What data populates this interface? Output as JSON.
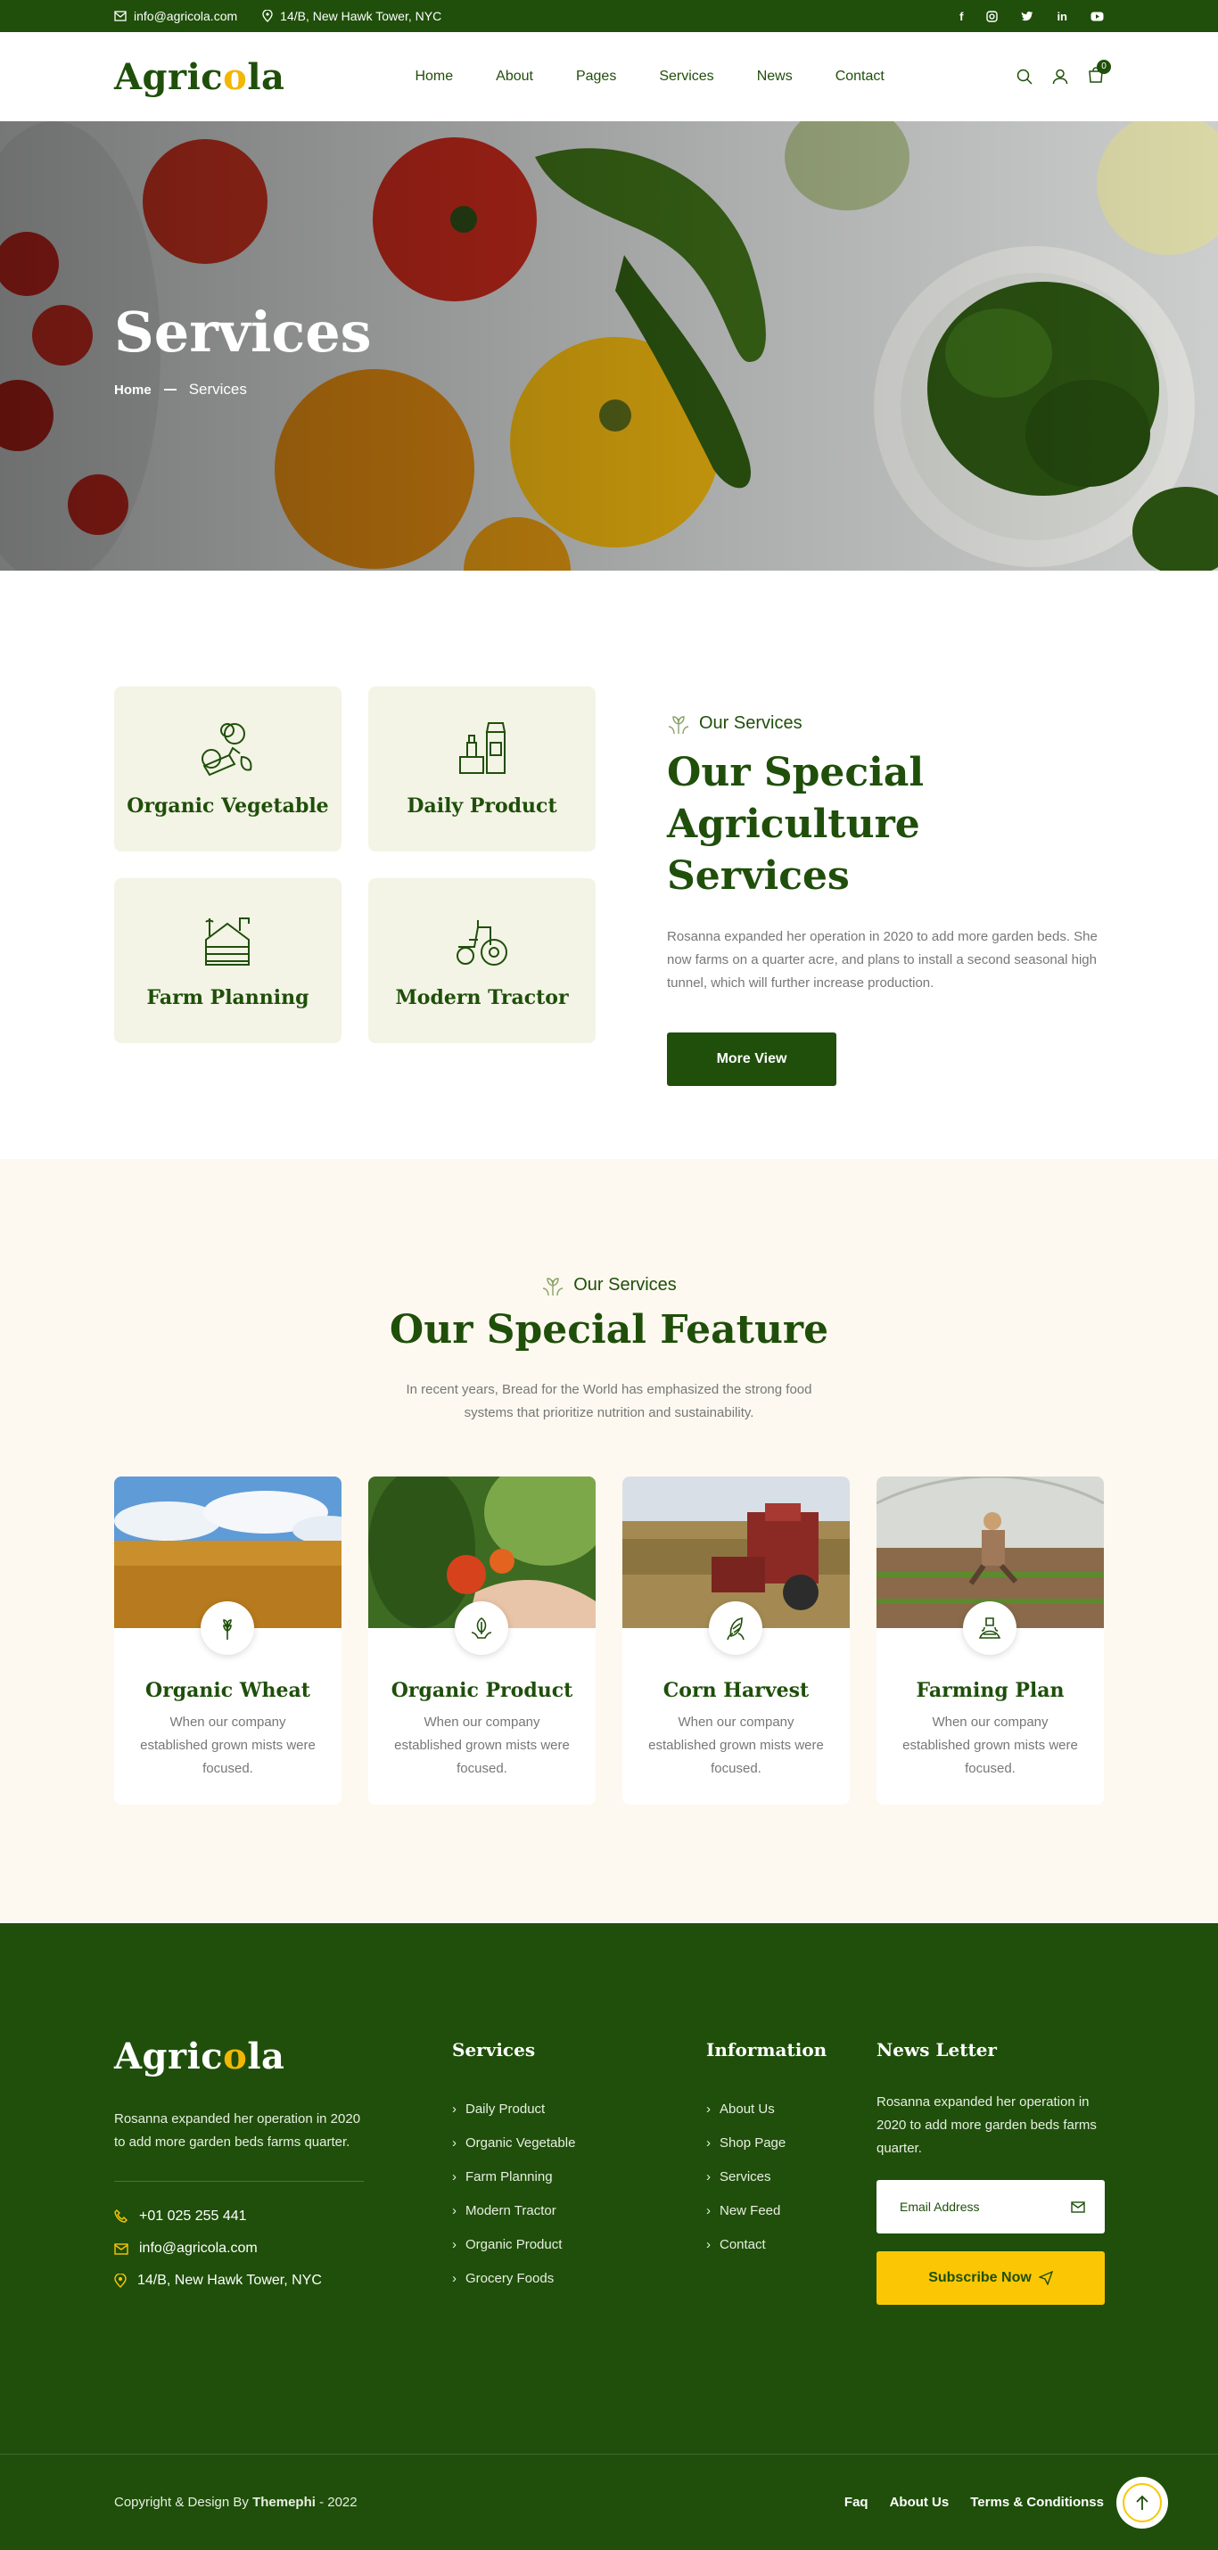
{
  "topbar": {
    "email": "info@agricola.com",
    "address": "14/B, New Hawk Tower, NYC",
    "social": [
      "f",
      "ig",
      "tw",
      "in",
      "yt"
    ]
  },
  "header": {
    "logo_pre": "Agric",
    "logo_o": "o",
    "logo_post": "la",
    "nav": [
      "Home",
      "About",
      "Pages",
      "Services",
      "News",
      "Contact"
    ],
    "cart_count": "0"
  },
  "hero": {
    "title": "Services",
    "breadcrumb_home": "Home",
    "breadcrumb_current": "Services"
  },
  "services": {
    "cards": [
      "Organic Vegetable",
      "Daily Product",
      "Farm Planning",
      "Modern Tractor"
    ],
    "tag": "Our Services",
    "title": "Our Special Agriculture Services",
    "text": "Rosanna expanded her operation in 2020 to add more garden beds. She now farms on a quarter acre, and plans to install a second seasonal high tunnel, which will further increase production.",
    "button": "More View"
  },
  "feature": {
    "tag": "Our Services",
    "title": "Our Special Feature",
    "text": "In recent years, Bread for the World has emphasized the strong food systems that prioritize nutrition and sustainability.",
    "cards": [
      {
        "title": "Organic Wheat",
        "text": "When our company established grown mists were focused."
      },
      {
        "title": "Organic Product",
        "text": "When our company established grown mists were focused."
      },
      {
        "title": "Corn Harvest",
        "text": "When our company established grown mists were focused."
      },
      {
        "title": "Farming Plan",
        "text": "When our company established grown mists were focused."
      }
    ]
  },
  "footer": {
    "logo_pre": "Agric",
    "logo_o": "o",
    "logo_post": "la",
    "about": "Rosanna expanded her operation in 2020 to add more garden beds farms quarter.",
    "phone": "+01 025 255 441",
    "email": "info@agricola.com",
    "address": "14/B, New Hawk Tower, NYC",
    "services_title": "Services",
    "services": [
      "Daily Product",
      "Organic Vegetable",
      "Farm Planning",
      "Modern Tractor",
      "Organic Product",
      "Grocery Foods"
    ],
    "info_title": "Information",
    "info": [
      "About Us",
      "Shop Page",
      "Services",
      "New Feed",
      "Contact"
    ],
    "newsletter_title": "News Letter",
    "newsletter_text": "Rosanna expanded her operation in 2020 to add more garden beds farms quarter.",
    "email_placeholder": "Email Address",
    "subscribe": "Subscribe Now",
    "copyright_pre": "Copyright & Design By ",
    "copyright_brand": "Themephi",
    "copyright_post": " - 2022",
    "bottom_links": [
      "Faq",
      "About Us",
      "Terms & Conditionss"
    ]
  },
  "colors": {
    "brand_green": "#1f4f0a",
    "accent_yellow": "#fbc705",
    "card_bg": "#f3f4e5",
    "feature_bg": "#fdf9f0"
  }
}
